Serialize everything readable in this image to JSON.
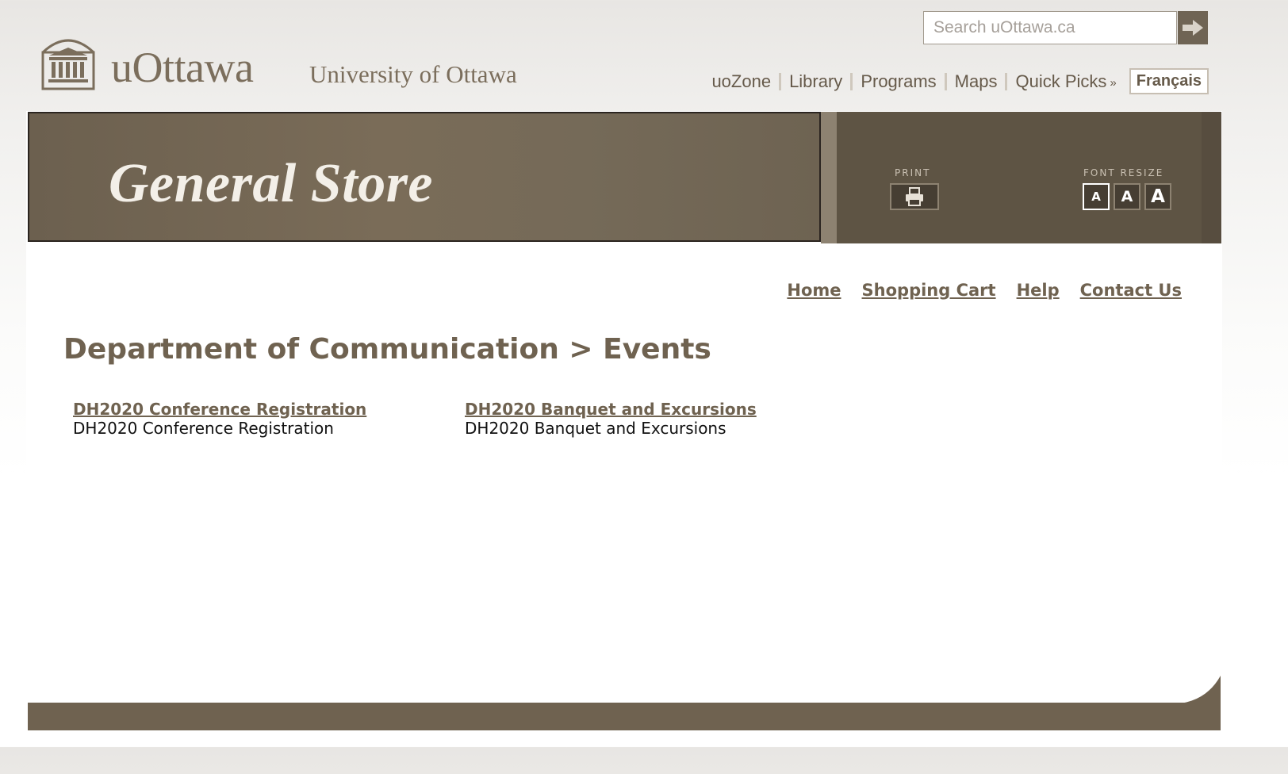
{
  "header": {
    "logo_text": "uOttawa",
    "university_name": "University of Ottawa",
    "search": {
      "placeholder": "Search uOttawa.ca",
      "value": ""
    },
    "nav": [
      "uoZone",
      "Library",
      "Programs",
      "Maps",
      "Quick Picks"
    ],
    "language_button": "Français"
  },
  "banner": {
    "title": "General Store",
    "print_label": "PRINT",
    "font_resize_label": "FONT RESIZE",
    "font_sizes": [
      "A",
      "A",
      "A"
    ]
  },
  "subnav": [
    "Home",
    "Shopping Cart",
    "Help",
    "Contact Us"
  ],
  "main": {
    "heading": "Department of Communication > Events",
    "items": [
      {
        "link": "DH2020 Conference Registration",
        "description": "DH2020 Conference Registration"
      },
      {
        "link": "DH2020 Banquet and Excursions",
        "description": "DH2020 Banquet and Excursions"
      }
    ]
  },
  "colors": {
    "brand": "#6f6250",
    "banner_dark": "#5e5444",
    "text": "#111111"
  },
  "icons": [
    "university-crest-icon",
    "arrow-right-icon",
    "chevron-double-down-icon",
    "printer-icon"
  ]
}
